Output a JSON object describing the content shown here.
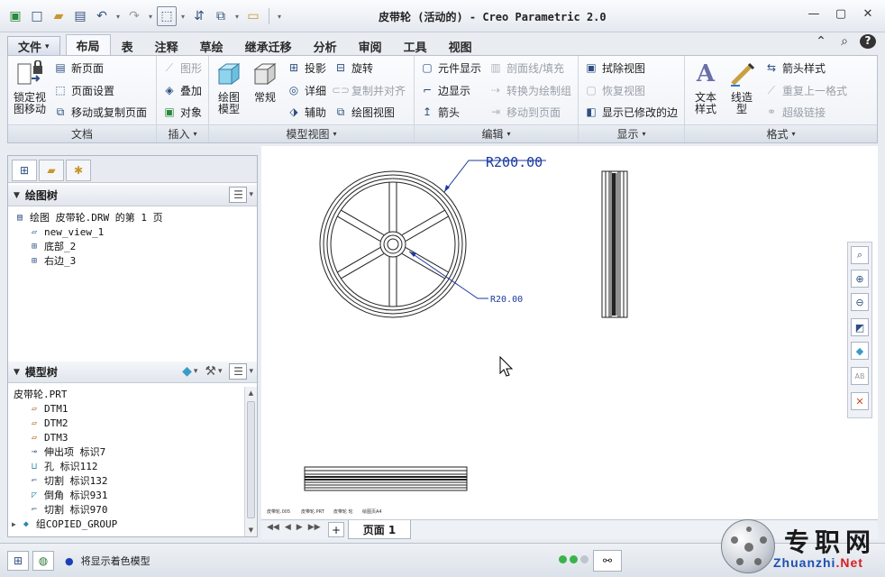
{
  "window": {
    "title": "皮带轮 (活动的) - Creo Parametric 2.0"
  },
  "menu_tabs": [
    {
      "label": "文件",
      "id": "file"
    },
    {
      "label": "布局",
      "id": "layout"
    },
    {
      "label": "表",
      "id": "table"
    },
    {
      "label": "注释",
      "id": "annotate"
    },
    {
      "label": "草绘",
      "id": "sketch"
    },
    {
      "label": "继承迁移",
      "id": "legacy"
    },
    {
      "label": "分析",
      "id": "analysis"
    },
    {
      "label": "审阅",
      "id": "review"
    },
    {
      "label": "工具",
      "id": "tools"
    },
    {
      "label": "视图",
      "id": "view"
    }
  ],
  "file_dropdown_arrow": "▾",
  "ribbon": {
    "doc": {
      "group_label": "文档",
      "lock_view": "锁定视图移动",
      "new_page": "新页面",
      "page_setup": "页面设置",
      "move_copy_pages": "移动或复制页面"
    },
    "insert": {
      "group_label": "插入",
      "graphic": "图形",
      "overlay": "叠加",
      "object": "对象"
    },
    "model_views": {
      "group_label": "模型视图",
      "drawing_models_1": "绘图",
      "drawing_models_2": "模型",
      "general": "常规",
      "projection": "投影",
      "detailed": "详细",
      "auxiliary": "辅助",
      "revolved": "旋转",
      "copy_align": "复制并对齐",
      "drawing_view": "绘图视图"
    },
    "edit": {
      "group_label": "编辑",
      "element_display": "元件显示",
      "edge_display": "边显示",
      "arrow": "箭头",
      "section_line": "剖面线/填充",
      "convert_group": "转换为绘制组",
      "move_to_page": "移动到页面"
    },
    "display": {
      "group_label": "显示",
      "erase_view": "拭除视图",
      "resume_view": "恢复视图",
      "show_modified_edges": "显示已修改的边"
    },
    "format": {
      "group_label": "格式",
      "text_style_1": "文本",
      "text_style_2": "样式",
      "line_style_1": "线造",
      "line_style_2": "型",
      "arrow_style": "箭头样式",
      "repeat_format": "重复上一格式",
      "hyperlink": "超级链接"
    }
  },
  "drawing_tree": {
    "title": "绘图树",
    "items": [
      {
        "label": "绘图 皮带轮.DRW 的第 1 页",
        "icon": "sheet-icon",
        "indent": 0
      },
      {
        "label": "new_view_1",
        "icon": "view-icon",
        "indent": 1
      },
      {
        "label": "底部_2",
        "icon": "projection-view-icon",
        "indent": 1
      },
      {
        "label": "右边_3",
        "icon": "projection-view-icon",
        "indent": 1
      }
    ]
  },
  "model_tree": {
    "title": "模型树",
    "items": [
      {
        "label": "皮带轮.PRT",
        "icon": "",
        "indent": 0,
        "expander": ""
      },
      {
        "label": "DTM1",
        "icon": "datum-plane-icon",
        "indent": 1,
        "expander": ""
      },
      {
        "label": "DTM2",
        "icon": "datum-plane-icon",
        "indent": 1,
        "expander": ""
      },
      {
        "label": "DTM3",
        "icon": "datum-plane-icon",
        "indent": 1,
        "expander": ""
      },
      {
        "label": "伸出项 标识7",
        "icon": "revolve-icon",
        "indent": 1,
        "expander": ""
      },
      {
        "label": "孔 标识112",
        "icon": "hole-icon",
        "indent": 1,
        "expander": ""
      },
      {
        "label": "切割 标识132",
        "icon": "cut-icon",
        "indent": 1,
        "expander": ""
      },
      {
        "label": "倒角 标识931",
        "icon": "chamfer-icon",
        "indent": 1,
        "expander": ""
      },
      {
        "label": "切割 标识970",
        "icon": "cut-icon",
        "indent": 1,
        "expander": ""
      },
      {
        "label": "组COPIED_GROUP",
        "icon": "group-icon",
        "indent": 0,
        "expander": "▶"
      }
    ]
  },
  "drawing": {
    "dim_outer": "R200.00",
    "dim_inner": "R20.00",
    "footer_labels": [
      "皮带轮.005",
      "皮带轮.PRT",
      "皮带轮 轮",
      "绘图页A4"
    ]
  },
  "page_bar": {
    "add_label": "+",
    "page_tab": "页面 1"
  },
  "status_bar": {
    "message": "将显示着色模型"
  },
  "watermark": {
    "cn": "专职网",
    "en_prefix": "Zhuanzhi",
    "en_suffix": ".Net"
  },
  "colors": {
    "dimension": "#1c3aa0",
    "accent": "#2d4f80",
    "status_light": "#3ab34a"
  }
}
